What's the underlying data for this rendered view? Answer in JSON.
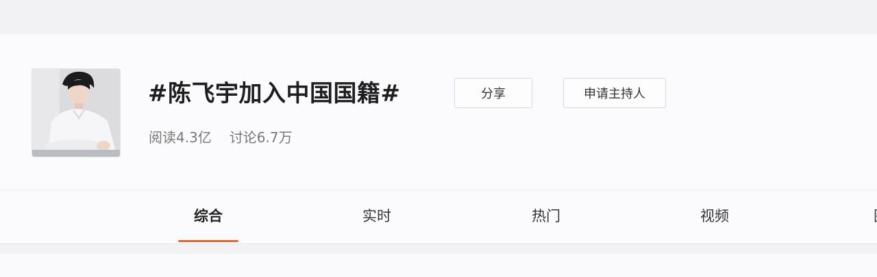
{
  "topic": {
    "title": "#陈飞宇加入中国国籍#",
    "stats": {
      "reads": "阅读4.3亿",
      "discussions": "讨论6.7万"
    }
  },
  "actions": {
    "share_label": "分享",
    "apply_host_label": "申请主持人"
  },
  "tabs": [
    {
      "label": "综合",
      "active": true
    },
    {
      "label": "实时",
      "active": false
    },
    {
      "label": "热门",
      "active": false
    },
    {
      "label": "视频",
      "active": false
    },
    {
      "label": "图",
      "active": false
    }
  ],
  "colors": {
    "accent_underline": "#d9682b"
  }
}
